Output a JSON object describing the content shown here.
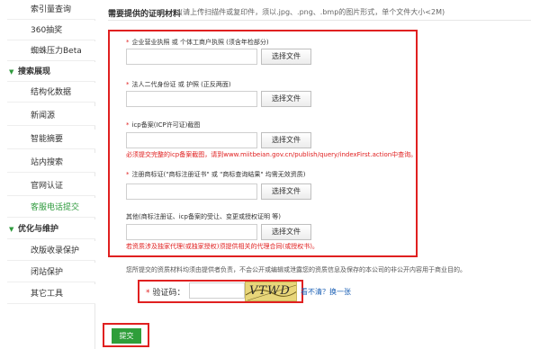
{
  "sidebar": {
    "items": [
      {
        "label": "索引量查询"
      },
      {
        "label": "360抽奖"
      },
      {
        "label": "蜘蛛压力Beta"
      },
      {
        "label": "搜索展现"
      },
      {
        "label": "结构化数据"
      },
      {
        "label": "新闻源"
      },
      {
        "label": "智能摘要"
      },
      {
        "label": "站内搜索"
      },
      {
        "label": "官网认证"
      },
      {
        "label": "客服电话提交"
      },
      {
        "label": "优化与维护"
      },
      {
        "label": "改版收录保护"
      },
      {
        "label": "闭站保护"
      },
      {
        "label": "其它工具"
      }
    ],
    "accent_color": "#2e9a3c"
  },
  "form": {
    "heading": "需要提供的证明材料",
    "hint": "(请上传扫描件或复印件，须以.jpg、.png、.bmp的图片形式，单个文件大小<2M)",
    "fields": [
      {
        "label": "企业营业执照 或 个体工商户执照 (须含年检部分)",
        "button": "选择文件"
      },
      {
        "label": "法人二代身份证 或 护照 (正反两面)",
        "button": "选择文件"
      },
      {
        "label": "icp备案(ICP许可证)截图",
        "button": "选择文件",
        "note": "必须提交完整的icp备案截图，请到www.miitbeian.gov.cn/publish/query/indexFirst.action中查询。"
      },
      {
        "label": "注册商标证(\"商标注册证书\" 或 \"商标查询结果\" 均需无效资质)",
        "button": "选择文件"
      },
      {
        "label": "其他(商标注册证、icp备案的受让、变更或授权证明 等)",
        "button": "选择文件",
        "note": "若资质涉及独家代理(或独家授权)须提供相关的代理合同(或授权书)。"
      }
    ],
    "disclaimer": "您所提交的资质材料均须由提供者负责，不会公开或编辑或泄露您的资质信息及保存的本公司的非公开内容用于商业目的。",
    "captcha": {
      "label": "验证码：",
      "value": "",
      "image_text": "VTWD",
      "refresh_link": "看不清？换一张"
    },
    "submit_label": "提交",
    "highlight_color": "#e02020",
    "link_color": "#1a5fb4"
  }
}
